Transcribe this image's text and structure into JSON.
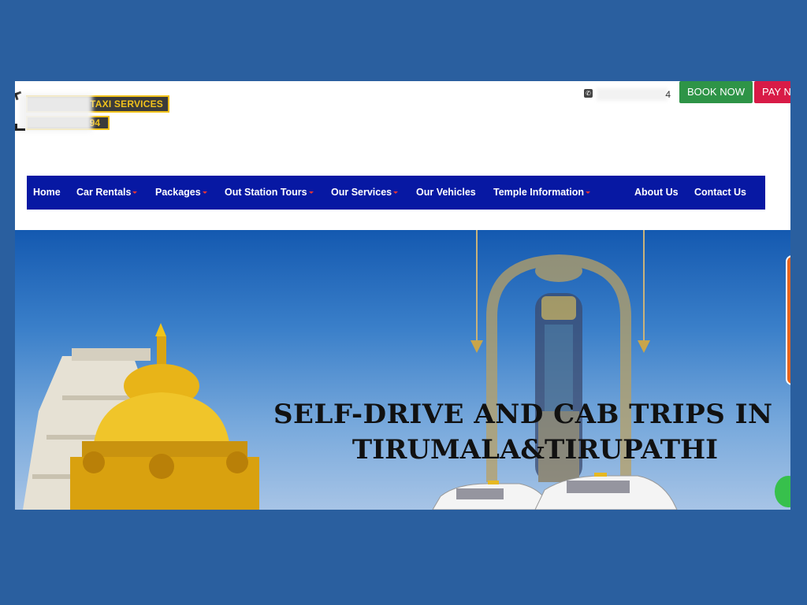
{
  "header": {
    "logo_text": "TAXI SERVICES",
    "logo_subtext": "94",
    "phone_suffix": "4",
    "book_now_label": "BOOK NOW",
    "pay_now_label": "PAY N"
  },
  "nav": {
    "items": [
      {
        "label": "Home",
        "has_dropdown": false
      },
      {
        "label": "Car Rentals",
        "has_dropdown": true
      },
      {
        "label": "Packages",
        "has_dropdown": true
      },
      {
        "label": "Out Station Tours",
        "has_dropdown": true
      },
      {
        "label": "Our Services",
        "has_dropdown": true
      },
      {
        "label": "Our Vehicles",
        "has_dropdown": false
      },
      {
        "label": "Temple Information",
        "has_dropdown": true
      },
      {
        "label": "About Us",
        "has_dropdown": false
      },
      {
        "label": "Contact Us",
        "has_dropdown": false
      }
    ]
  },
  "hero": {
    "headline_line1": "SELF-DRIVE AND CAB TRIPS IN",
    "headline_line2": "TIRUMALA&TIRUPATHI"
  },
  "icons": {
    "phone": "phone-icon",
    "whatsapp": "whatsapp-icon",
    "nav_caret": "caret-down-icon"
  },
  "colors": {
    "page_background": "#2a5f9f",
    "nav_background": "#0718a3",
    "book_button": "#2e9447",
    "pay_button": "#d81b47",
    "logo_accent": "#f1c21b",
    "nav_caret": "#e83535",
    "side_tab": "#e8641d"
  }
}
